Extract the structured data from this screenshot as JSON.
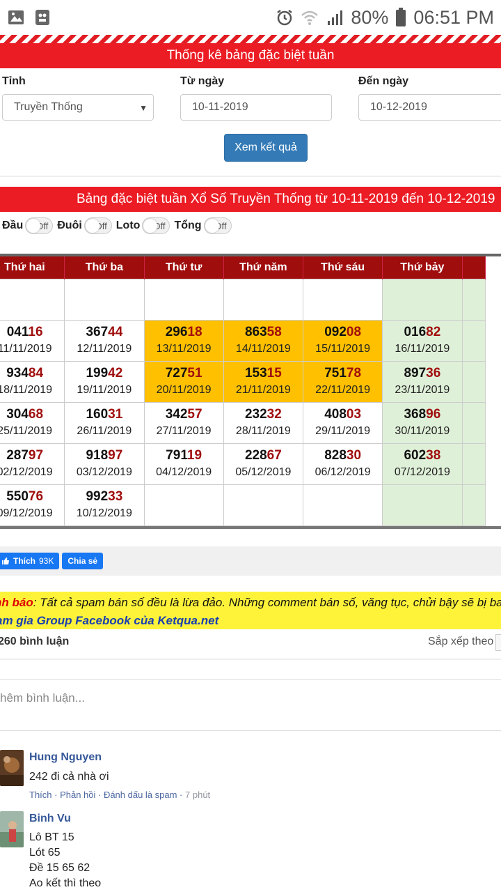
{
  "status_bar": {
    "battery": "80%",
    "time": "06:51 PM"
  },
  "filter_section": {
    "title": "Thống kê bảng đặc biệt tuần",
    "province_label": "Tỉnh",
    "province_value": "Truyền Thống",
    "from_label": "Từ ngày",
    "from_value": "10-11-2019",
    "to_label": "Đến ngày",
    "to_value": "10-12-2019",
    "submit_label": "Xem kết quả"
  },
  "results": {
    "title": "Bảng đặc biệt tuần Xổ Số Truyền Thống từ 10-11-2019 đến 10-12-2019",
    "toggles": [
      {
        "label": "Đầu",
        "state": "Off"
      },
      {
        "label": "Đuôi",
        "state": "Off"
      },
      {
        "label": "Loto",
        "state": "Off"
      },
      {
        "label": "Tổng",
        "state": "Off"
      }
    ],
    "columns": [
      "Thứ hai",
      "Thứ ba",
      "Thứ tư",
      "Thứ năm",
      "Thứ sáu",
      "Thứ bảy"
    ],
    "rows": [
      [
        null,
        null,
        null,
        null,
        null,
        null
      ],
      [
        {
          "head": "041",
          "tail": "16",
          "date": "11/11/2019"
        },
        {
          "head": "367",
          "tail": "44",
          "date": "12/11/2019"
        },
        {
          "head": "296",
          "tail": "18",
          "date": "13/11/2019",
          "highlight": true
        },
        {
          "head": "863",
          "tail": "58",
          "date": "14/11/2019",
          "highlight": true
        },
        {
          "head": "092",
          "tail": "08",
          "date": "15/11/2019",
          "highlight": true
        },
        {
          "head": "016",
          "tail": "82",
          "date": "16/11/2019"
        }
      ],
      [
        {
          "head": "934",
          "tail": "84",
          "date": "18/11/2019"
        },
        {
          "head": "199",
          "tail": "42",
          "date": "19/11/2019"
        },
        {
          "head": "727",
          "tail": "51",
          "date": "20/11/2019",
          "highlight": true
        },
        {
          "head": "153",
          "tail": "15",
          "date": "21/11/2019",
          "highlight": true
        },
        {
          "head": "751",
          "tail": "78",
          "date": "22/11/2019",
          "highlight": true
        },
        {
          "head": "897",
          "tail": "36",
          "date": "23/11/2019"
        }
      ],
      [
        {
          "head": "304",
          "tail": "68",
          "date": "25/11/2019"
        },
        {
          "head": "160",
          "tail": "31",
          "date": "26/11/2019"
        },
        {
          "head": "342",
          "tail": "57",
          "date": "27/11/2019"
        },
        {
          "head": "232",
          "tail": "32",
          "date": "28/11/2019"
        },
        {
          "head": "408",
          "tail": "03",
          "date": "29/11/2019"
        },
        {
          "head": "368",
          "tail": "96",
          "date": "30/11/2019"
        }
      ],
      [
        {
          "head": "287",
          "tail": "97",
          "date": "02/12/2019"
        },
        {
          "head": "918",
          "tail": "97",
          "date": "03/12/2019"
        },
        {
          "head": "791",
          "tail": "19",
          "date": "04/12/2019"
        },
        {
          "head": "228",
          "tail": "67",
          "date": "05/12/2019"
        },
        {
          "head": "828",
          "tail": "30",
          "date": "06/12/2019"
        },
        {
          "head": "602",
          "tail": "38",
          "date": "07/12/2019"
        }
      ],
      [
        {
          "head": "550",
          "tail": "76",
          "date": "09/12/2019"
        },
        {
          "head": "992",
          "tail": "33",
          "date": "10/12/2019"
        },
        null,
        null,
        null,
        null
      ]
    ]
  },
  "social": {
    "like_label": "Thích",
    "like_count": "93K",
    "share_label": "Chia sẻ"
  },
  "warning": {
    "prefix": "nh báo",
    "text": ": Tất cả spam bán số đều là lừa đảo. Những comment bán số, văng tục, chửi bậy sẽ bị ban",
    "group_text": "am gia Group Facebook của Ketqua.net"
  },
  "comments": {
    "count_label": "260 bình luận",
    "sort_label": "Sắp xếp theo",
    "input_placeholder": "hêm bình luận...",
    "items": [
      {
        "name": "Hung Nguyen",
        "text": "242 đi cả nhà ơi",
        "actions": "Thích · Phản hồi · Đánh dấu là spam · ",
        "time": "7 phút"
      },
      {
        "name": "Binh Vu",
        "text": "Lô BT 15\nLót 65\nĐề 15 65 62\nAo kết thì theo"
      }
    ]
  }
}
